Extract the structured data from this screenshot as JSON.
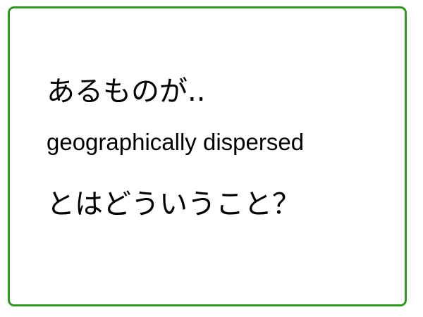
{
  "card": {
    "line1": "あるものが..",
    "line2": "geographically dispersed",
    "line3": "とはどういうこと？"
  },
  "colors": {
    "border": "#2e9a1e",
    "text": "#000000",
    "background": "#ffffff"
  }
}
